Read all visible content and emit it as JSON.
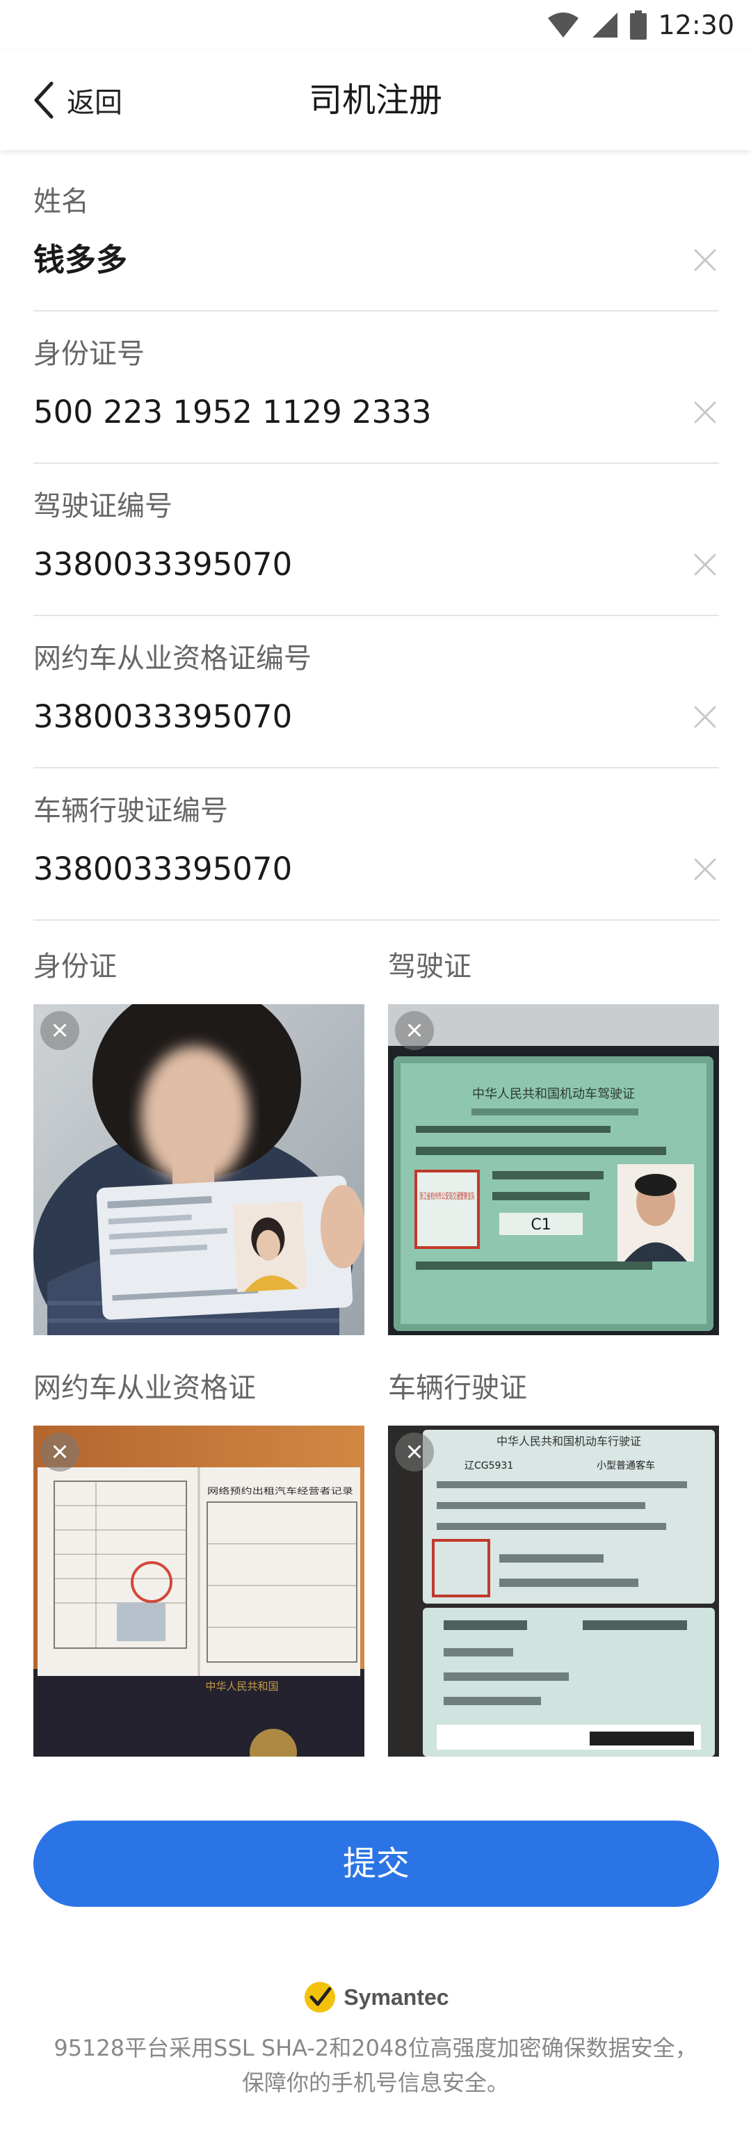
{
  "status_bar": {
    "time": "12:30"
  },
  "nav": {
    "back_label": "返回",
    "title": "司机注册"
  },
  "form": {
    "fields": [
      {
        "label": "姓名",
        "value": "钱多多"
      },
      {
        "label": "身份证号",
        "value": "500 223 1952 1129 2333"
      },
      {
        "label": "驾驶证编号",
        "value": "3380033395070"
      },
      {
        "label": "网约车从业资格证编号",
        "value": "3380033395070"
      },
      {
        "label": "车辆行驶证编号",
        "value": "3380033395070"
      }
    ]
  },
  "photos": [
    {
      "label": "身份证"
    },
    {
      "label": "驾驶证"
    },
    {
      "label": "网约车从业资格证"
    },
    {
      "label": "车辆行驶证"
    }
  ],
  "photo_texts": {
    "license_title": "中华人民共和国机动车驾驶证",
    "license_stamp": "浙江省杭州市公安局交通警察支队",
    "license_class": "C1",
    "cert_title": "网络预约出租汽车经营者记录",
    "registration_title": "中华人民共和国机动车行驶证",
    "registration_plate": "辽CG5931",
    "registration_type": "小型普通客车"
  },
  "submit": {
    "label": "提交"
  },
  "footer": {
    "brand": "Symantec",
    "line1": "95128平台采用SSL SHA-2和2048位高强度加密确保数据安全，",
    "line2": "保障你的手机号信息安全。"
  },
  "colors": {
    "primary": "#2b74e6",
    "label": "#666666",
    "divider": "#e4e4e4"
  }
}
